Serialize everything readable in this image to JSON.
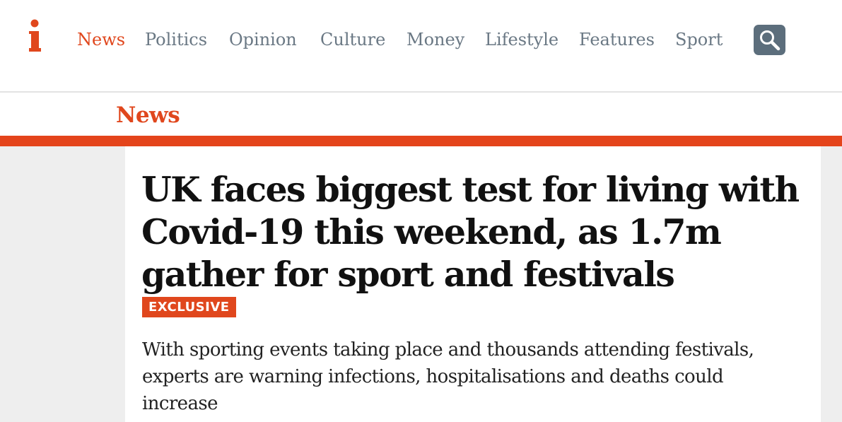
{
  "header": {
    "logo_text": "i",
    "nav": [
      {
        "label": "News",
        "active": true
      },
      {
        "label": "Politics",
        "active": false
      },
      {
        "label": "Opinion",
        "active": false
      },
      {
        "label": "Culture",
        "active": false
      },
      {
        "label": "Money",
        "active": false
      },
      {
        "label": "Lifestyle",
        "active": false
      },
      {
        "label": "Features",
        "active": false
      },
      {
        "label": "Sport",
        "active": false
      }
    ],
    "search_icon": "search-icon"
  },
  "section": {
    "title": "News"
  },
  "article": {
    "headline": "UK faces biggest test for living with Covid-19 this weekend, as 1.7m gather for sport and festivals",
    "badge": "EXCLUSIVE",
    "standfirst": "With sporting events taking place and thousands attending festivals, experts are warning infections, hospitalisations and deaths could increase"
  },
  "colors": {
    "accent": "#e0471d",
    "nav_text": "#6a7884",
    "search_bg": "#5c6e7c",
    "headline": "#111111"
  }
}
